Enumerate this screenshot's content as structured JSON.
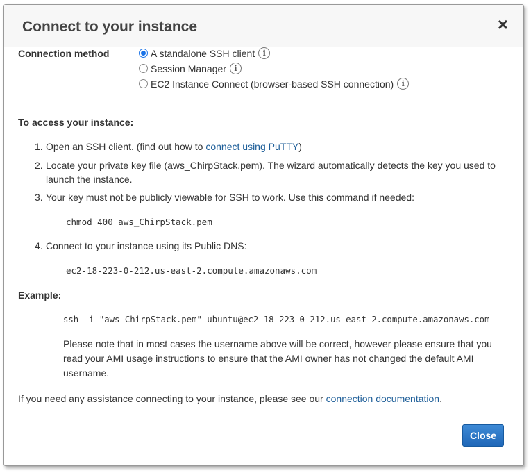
{
  "dialog": {
    "title": "Connect to your instance",
    "close_icon": "×"
  },
  "connection": {
    "label": "Connection method",
    "options": [
      {
        "label": "A standalone SSH client",
        "checked": true
      },
      {
        "label": "Session Manager",
        "checked": false
      },
      {
        "label": "EC2 Instance Connect (browser-based SSH connection)",
        "checked": false
      }
    ],
    "info_glyph": "i"
  },
  "access": {
    "heading": "To access your instance:",
    "steps": [
      {
        "num": "1.",
        "text_before": "Open an SSH client. (find out how to ",
        "link": "connect using PuTTY",
        "text_after": ")"
      },
      {
        "num": "2.",
        "text": "Locate your private key file (aws_ChirpStack.pem). The wizard automatically detects the key you used to launch the instance."
      },
      {
        "num": "3.",
        "text": "Your key must not be publicly viewable for SSH to work. Use this command if needed:"
      },
      {
        "num": "4.",
        "text": "Connect to your instance using its Public DNS:"
      }
    ],
    "chmod_cmd": "chmod 400 aws_ChirpStack.pem",
    "public_dns": "ec2-18-223-0-212.us-east-2.compute.amazonaws.com"
  },
  "example": {
    "heading": "Example:",
    "ssh_cmd": "ssh -i \"aws_ChirpStack.pem\" ubuntu@ec2-18-223-0-212.us-east-2.compute.amazonaws.com",
    "note": "Please note that in most cases the username above will be correct, however please ensure that you read your AMI usage instructions to ensure that the AMI owner has not changed the default AMI username."
  },
  "assist": {
    "text": "If you need any assistance connecting to your instance, please see our ",
    "link": "connection documentation",
    "suffix": "."
  },
  "footer": {
    "close_label": "Close"
  },
  "colors": {
    "primary": "#1f67b8",
    "link": "#1f5f99"
  }
}
